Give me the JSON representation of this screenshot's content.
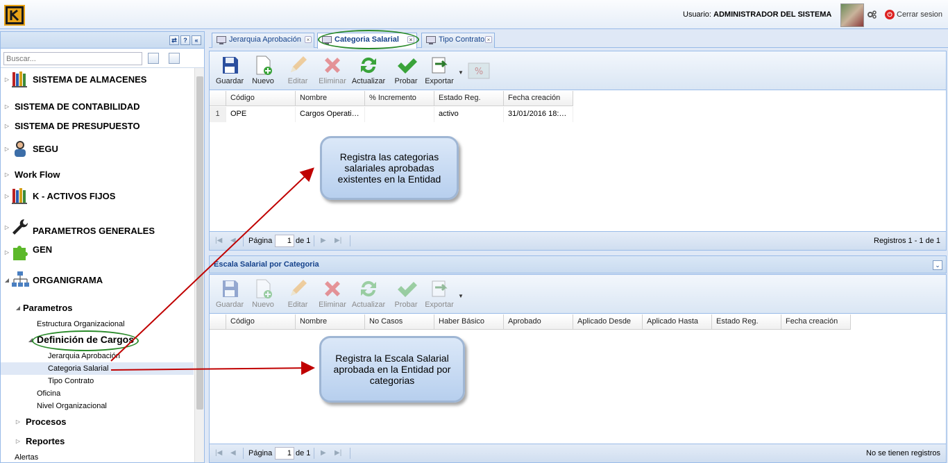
{
  "header": {
    "user_prefix": "Usuario: ",
    "user_name": "ADMINISTRADOR DEL SISTEMA",
    "logout": "Cerrar sesion",
    "logo_letter": "K"
  },
  "sidebar": {
    "search_placeholder": "Buscar...",
    "items": [
      {
        "label": "SISTEMA DE ALMACENES"
      },
      {
        "label": "SISTEMA DE CONTABILIDAD"
      },
      {
        "label": "SISTEMA DE PRESUPUESTO"
      },
      {
        "label": "SEGU"
      },
      {
        "label": "Work Flow"
      },
      {
        "label": "K - ACTIVOS FIJOS"
      },
      {
        "label": "PARAMETROS GENERALES"
      },
      {
        "label": "GEN"
      },
      {
        "label": "ORGANIGRAMA"
      },
      {
        "label": "Parametros"
      },
      {
        "label": "Estructura Organizacional"
      },
      {
        "label": "Definición de Cargos"
      },
      {
        "label": "Jerarquia Aprobación"
      },
      {
        "label": "Categoria Salarial"
      },
      {
        "label": "Tipo Contrato"
      },
      {
        "label": "Oficina"
      },
      {
        "label": "Nivel Organizacional"
      },
      {
        "label": "Procesos"
      },
      {
        "label": "Reportes"
      },
      {
        "label": "Alertas"
      }
    ]
  },
  "tabs": [
    {
      "label": "Jerarquia Aprobación"
    },
    {
      "label": "Categoria Salarial"
    },
    {
      "label": "Tipo Contrato"
    }
  ],
  "toolbar": {
    "guardar": "Guardar",
    "nuevo": "Nuevo",
    "editar": "Editar",
    "eliminar": "Eliminar",
    "actualizar": "Actualizar",
    "probar": "Probar",
    "exportar": "Exportar"
  },
  "grid1": {
    "columns": [
      "Código",
      "Nombre",
      "% Incremento",
      "Estado Reg.",
      "Fecha creación"
    ],
    "rows": [
      {
        "num": "1",
        "codigo": "OPE",
        "nombre": "Cargos Operativ...",
        "incremento": "",
        "estado": "activo",
        "fecha": "31/01/2016 18:1..."
      }
    ],
    "pager": {
      "page_label": "Página",
      "page": "1",
      "of": "de 1",
      "info": "Registros 1 - 1 de 1"
    }
  },
  "grid2": {
    "title": "Escala Salarial por Categoria",
    "columns": [
      "Código",
      "Nombre",
      "No Casos",
      "Haber Básico",
      "Aprobado",
      "Aplicado Desde",
      "Aplicado Hasta",
      "Estado Reg.",
      "Fecha creación"
    ],
    "pager": {
      "page_label": "Página",
      "page": "1",
      "of": "de 1",
      "info": "No se tienen registros"
    }
  },
  "callouts": {
    "first": "Registra las categorias salariales aprobadas existentes en la Entidad",
    "second": "Registra la Escala Salarial aprobada en la Entidad por categorias"
  },
  "colors": {
    "accent": "#15428b",
    "border": "#99bbe8",
    "arrow": "#c00000",
    "highlight_ellipse": "#2a8a2a"
  }
}
